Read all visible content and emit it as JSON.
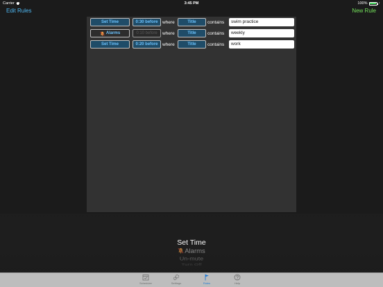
{
  "status_bar": {
    "carrier": "Carrier",
    "time": "3:45 PM",
    "battery": "100%"
  },
  "nav": {
    "left": "Edit Rules",
    "right": "New Rule"
  },
  "rules": [
    {
      "action": "Set Time",
      "action_icon": "",
      "offset": "0:30 before",
      "offset_enabled": true,
      "connector": "where",
      "field": "Title",
      "operator": "contains",
      "value": "swim practice"
    },
    {
      "action": "Alarms",
      "action_icon": "bell-mute-icon",
      "offset": "0:10 before",
      "offset_enabled": false,
      "connector": "where",
      "field": "Title",
      "operator": "contains",
      "value": "weekly"
    },
    {
      "action": "Set Time",
      "action_icon": "",
      "offset": "0:20 before",
      "offset_enabled": true,
      "connector": "where",
      "field": "Title",
      "operator": "contains",
      "value": "work"
    }
  ],
  "picker": {
    "items": [
      "Set Time",
      "Alarms",
      "Un-mute",
      "Turn Off"
    ],
    "selected": "Set Time"
  },
  "tabs": [
    {
      "label": "Scheduler",
      "icon": "calendar-icon",
      "active": false
    },
    {
      "label": "Settings",
      "icon": "gears-icon",
      "active": false
    },
    {
      "label": "Rules",
      "icon": "flag-icon",
      "active": true
    },
    {
      "label": "Help",
      "icon": "question-icon",
      "active": false
    }
  ],
  "colors": {
    "accent_blue": "#4fb8f2",
    "accent_green": "#74e35b",
    "button_bg": "#1f4c68",
    "tab_active": "#1f7ad6"
  }
}
